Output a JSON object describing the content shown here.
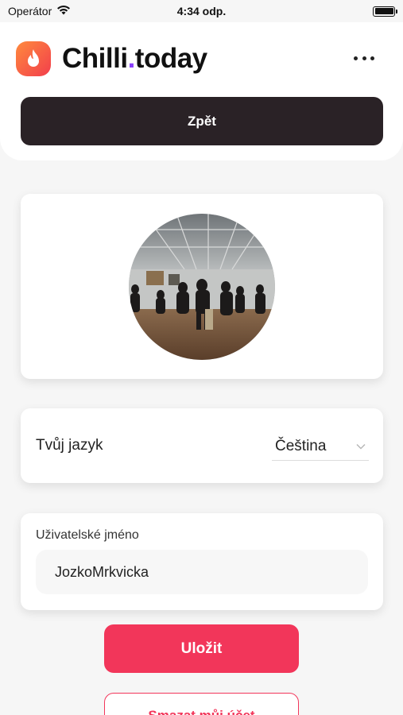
{
  "status_bar": {
    "carrier": "Operátor",
    "time": "4:34 odp.",
    "battery_level": 1.0
  },
  "header": {
    "logo_text_main": "Chilli",
    "logo_text_dot": ".",
    "logo_text_suffix": "today",
    "back_label": "Zpět"
  },
  "language": {
    "label": "Tvůj jazyk",
    "selected": "Čeština"
  },
  "username": {
    "label": "Uživatelské jméno",
    "value": "JozkoMrkvicka"
  },
  "actions": {
    "save_label": "Uložit",
    "delete_label": "Smazat můj účet"
  },
  "colors": {
    "accent": "#f2365a",
    "dark_button": "#2a2226",
    "logo_gradient_start": "#ff8a3d",
    "logo_gradient_end": "#f23e4c",
    "logo_dot": "#8a3ffc"
  }
}
